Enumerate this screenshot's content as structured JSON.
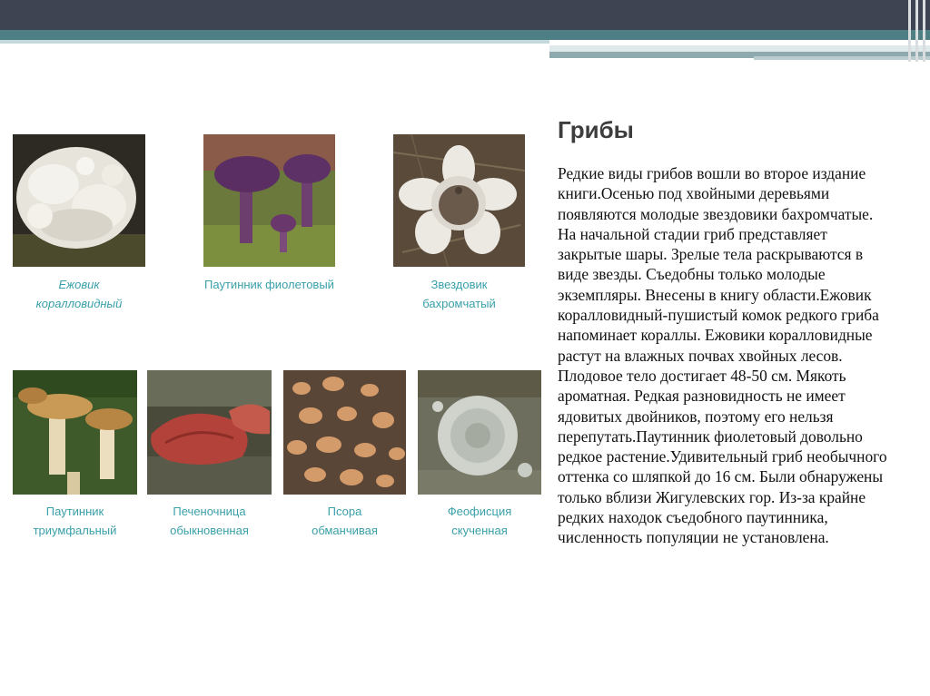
{
  "slide": {
    "title": "Грибы",
    "body": "Редкие виды грибов вошли во второе издание книги.Осенью под хвойными деревьями появляются молодые звездовики бахромчатые. На начальной стадии гриб представляет закрытые шары. Зрелые тела раскрываются в виде звезды. Съедобны только молодые экземпляры. Внесены в книгу области.Ежовик коралловидный-пушистый комок редкого гриба напоминает кораллы. Ежовики коралловидные растут на влажных почвах хвойных лесов. Плодовое тело достигает 48-50 см. Мякоть ароматная. Редкая разновидность не имеет ядовитых двойников, поэтому его нельзя перепутать.Паутинник фиолетовый довольно редкое растение.Удивительный гриб необычного оттенка со шляпкой до 16 см.  Были обнаружены только вблизи Жигулевских гор. Из-за крайне редких находок съедобного паутинника, численность популяции не установлена."
  },
  "mushrooms": [
    {
      "line1": "Ежовик",
      "line2": "коралловидный",
      "icon": "hericium-photo"
    },
    {
      "line1": "Паутинник фиолетовый",
      "line2": "",
      "icon": "cortinarius-violaceus-photo"
    },
    {
      "line1": "Звездовик",
      "line2": "бахромчатый",
      "icon": "geastrum-photo"
    },
    {
      "line1": "Паутинник",
      "line2": "триумфальный",
      "icon": "cortinarius-triumphans-photo"
    },
    {
      "line1": "Печеночница",
      "line2": "обыкновенная",
      "icon": "fistulina-photo"
    },
    {
      "line1": "Псора",
      "line2": "обманчивая",
      "icon": "psora-photo"
    },
    {
      "line1": "Феофисция",
      "line2": "скученная",
      "icon": "phaeophyscia-photo"
    }
  ],
  "colors": {
    "caption": "#3aa0a9",
    "header_dark": "#3f4452",
    "header_teal": "#4e7f85"
  }
}
